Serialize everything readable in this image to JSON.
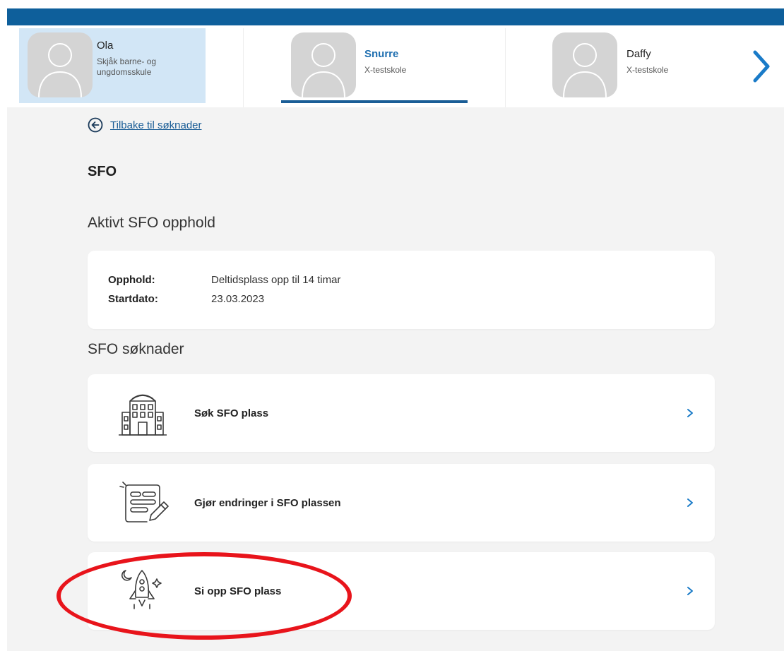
{
  "children": [
    {
      "name": "Ola",
      "school": "Skjåk barne- og ungdomsskule"
    },
    {
      "name": "Snurre",
      "school": "X-testskole"
    },
    {
      "name": "Daffy",
      "school": "X-testskole"
    }
  ],
  "back_link": "Tilbake til søknader",
  "page_title": "SFO",
  "active_stay": {
    "heading": "Aktivt SFO opphold",
    "rows": [
      {
        "key": "Opphold:",
        "value": "Deltidsplass opp til 14 timar"
      },
      {
        "key": "Startdato:",
        "value": "23.03.2023"
      }
    ]
  },
  "applications": {
    "heading": "SFO søknader",
    "items": [
      {
        "label": "Søk SFO plass",
        "icon": "school-building-icon"
      },
      {
        "label": "Gjør endringer i SFO plassen",
        "icon": "form-edit-icon"
      },
      {
        "label": "Si opp SFO plass",
        "icon": "rocket-icon"
      }
    ]
  },
  "colors": {
    "topbar": "#0e5f9b",
    "accent": "#1a5d96",
    "selected_child_bg": "#d2e6f6",
    "highlight_ring": "#e8141b",
    "page_bg": "#f3f3f3"
  }
}
